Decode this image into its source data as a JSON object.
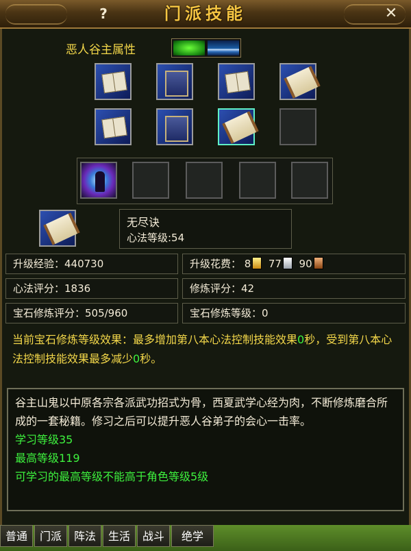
{
  "window": {
    "title": "门派技能",
    "help_label": "?",
    "close_label": "✕"
  },
  "attribute": {
    "label": "恶人谷主属性",
    "elements": [
      "wood",
      "water"
    ]
  },
  "skill_grid": {
    "row1": [
      "book-icon",
      "tome-icon",
      "book-icon",
      "scroll-icon"
    ],
    "row2": [
      "book-icon",
      "tome-icon",
      "scroll-icon",
      "empty"
    ],
    "selected_index": 6
  },
  "skill_bar": [
    "magic-skill-icon",
    "empty",
    "empty",
    "empty",
    "empty"
  ],
  "current_skill": {
    "name": "无尽诀",
    "level_label": "心法等级:54"
  },
  "stats": {
    "exp_label": "升级经验：440730",
    "cost_label": "升级花费：",
    "cost_gold": "8",
    "cost_silver": "77",
    "cost_copper": "90",
    "score_label": "心法评分：1836",
    "cultivate_score_label": "修炼评分：42",
    "gem_score_label": "宝石修炼评分：505/960",
    "gem_level_label": "宝石修炼等级：0"
  },
  "effect": {
    "part1": "当前宝石修炼等级效果：最多增加第八本心法控制技能效果",
    "value1": "0",
    "part2": "秒，受到第八本心法控制技能效果最多减少",
    "value2": "0",
    "part3": "秒。"
  },
  "description": {
    "text": "谷主山鬼以中原各宗各派武功招式为骨，西夏武学心经为肉，不断修炼磨合所成的一套秘籍。修习之后可以提升恶人谷弟子的会心一击率。",
    "learn_level": "学习等级35",
    "max_level": "最高等级119",
    "limit_note": "可学习的最高等级不能高于角色等级5级"
  },
  "tabs": [
    "普通",
    "门派",
    "阵法",
    "生活",
    "战斗",
    "绝学"
  ],
  "colors": {
    "title": "#f4c442",
    "highlight_yellow": "#f4d84a",
    "green_text": "#3ef23e",
    "selected_border": "#5ff0c6"
  }
}
